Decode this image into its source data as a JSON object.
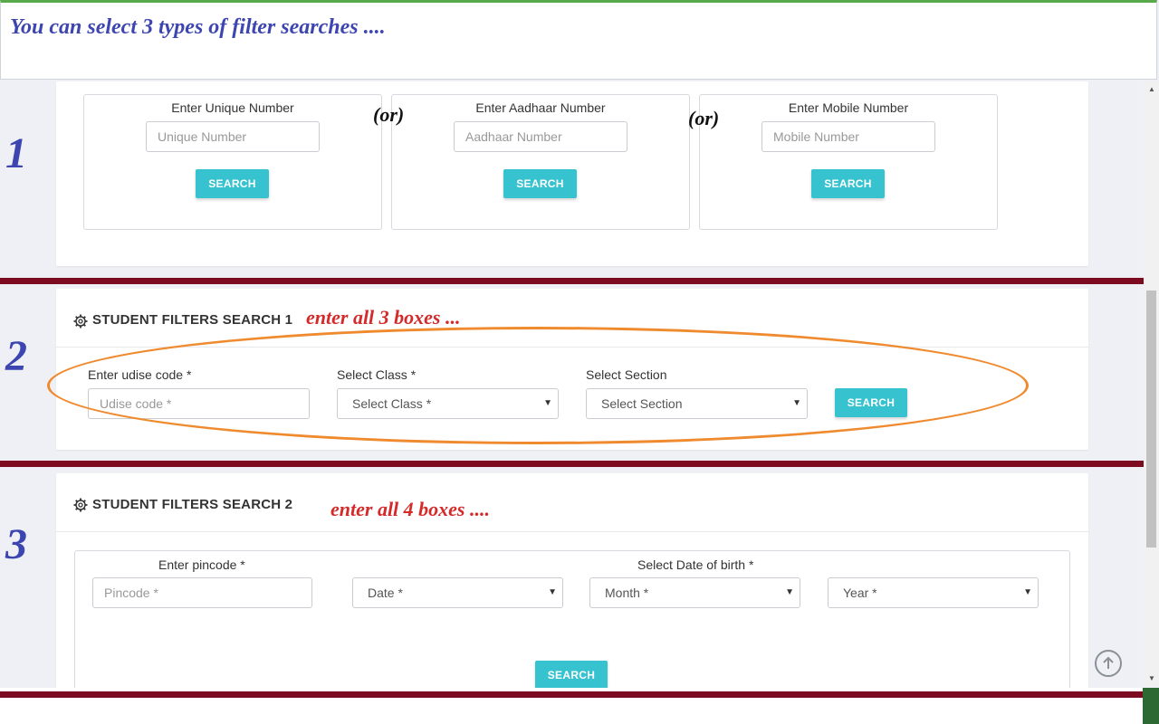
{
  "banner": {
    "text": "You can select 3 types of filter searches ...."
  },
  "steps": [
    "1",
    "2",
    "3"
  ],
  "quick_search": {
    "boxes": [
      {
        "label": "Enter Unique Number",
        "placeholder": "Unique Number",
        "button": "SEARCH"
      },
      {
        "label": "Enter Aadhaar Number",
        "placeholder": "Aadhaar Number",
        "button": "SEARCH"
      },
      {
        "label": "Enter Mobile Number",
        "placeholder": "Mobile Number",
        "button": "SEARCH"
      }
    ],
    "or_text": "(or)"
  },
  "filter1": {
    "title": "STUDENT FILTERS SEARCH 1",
    "note": "enter all 3 boxes ...",
    "udise": {
      "label": "Enter udise code *",
      "placeholder": "Udise code *"
    },
    "class": {
      "label": "Select Class *",
      "value": "Select Class *"
    },
    "section": {
      "label": "Select Section",
      "value": "Select Section"
    },
    "button": "SEARCH"
  },
  "filter2": {
    "title": "STUDENT FILTERS SEARCH 2",
    "note": "enter all 4 boxes ....",
    "pincode": {
      "label": "Enter pincode *",
      "placeholder": "Pincode *"
    },
    "dob_label": "Select Date of birth *",
    "date": "Date *",
    "month": "Month *",
    "year": "Year *",
    "button": "SEARCH"
  },
  "colors": {
    "accent": "#36c3cf",
    "annotation_blue": "#3d46b0",
    "annotation_red": "#d42a2a",
    "divider": "#7c0a21",
    "ellipse": "#ef8a2e"
  }
}
